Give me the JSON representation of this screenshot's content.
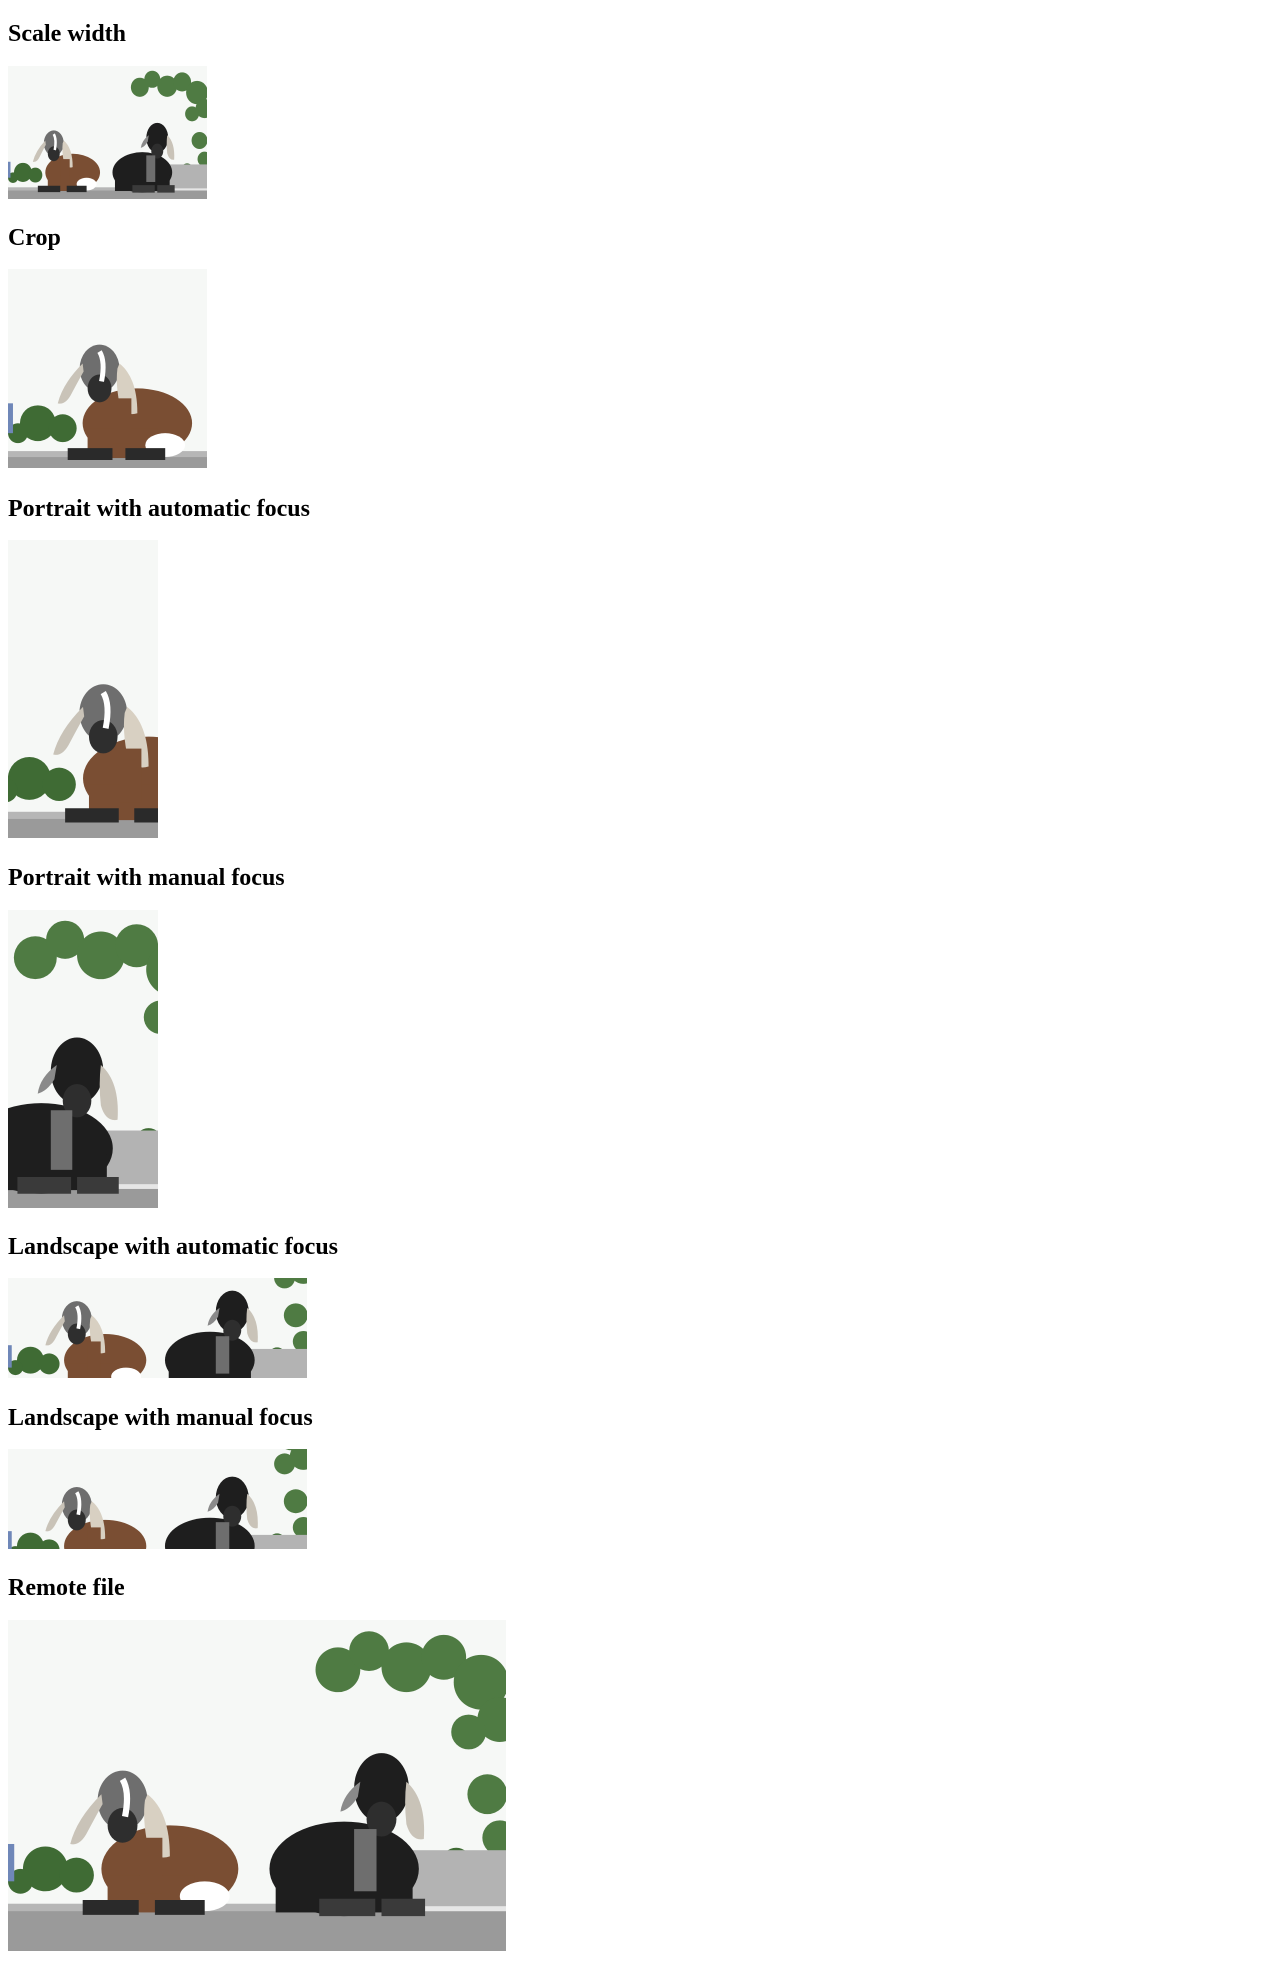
{
  "sections": [
    {
      "heading": "Scale width",
      "image": {
        "subject": "two-goats-photo",
        "variant": "scaled"
      }
    },
    {
      "heading": "Crop",
      "image": {
        "subject": "two-goats-photo",
        "variant": "crop"
      }
    },
    {
      "heading": "Portrait with automatic focus",
      "image": {
        "subject": "two-goats-photo",
        "variant": "portrait-auto"
      }
    },
    {
      "heading": "Portrait with manual focus",
      "image": {
        "subject": "two-goats-photo",
        "variant": "portrait-manual"
      }
    },
    {
      "heading": "Landscape with automatic focus",
      "image": {
        "subject": "two-goats-photo",
        "variant": "landscape-auto"
      }
    },
    {
      "heading": "Landscape with manual focus",
      "image": {
        "subject": "two-goats-photo",
        "variant": "landscape-manual"
      }
    },
    {
      "heading": "Remote file",
      "image": {
        "subject": "two-goats-photo",
        "variant": "remote"
      }
    }
  ],
  "colors": {
    "sky": "#f6f8f6",
    "ground": "#9a9a9a",
    "tree": "#3f6b34",
    "goat_brown": "#7a4e33",
    "goat_black": "#1e1e1e",
    "goat_gray": "#6e6e6e"
  }
}
